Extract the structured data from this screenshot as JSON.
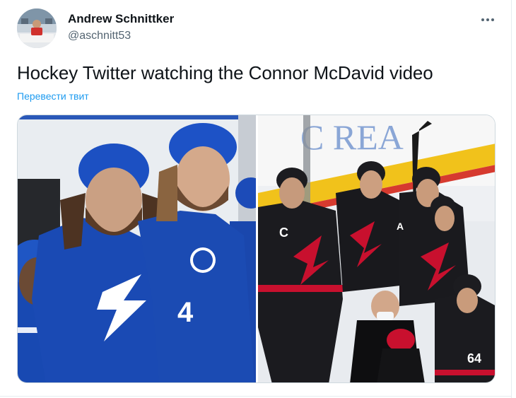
{
  "author": {
    "display_name": "Andrew Schnittker",
    "handle": "@aschnitt53"
  },
  "tweet": {
    "text": "Hockey Twitter watching the Connor McDavid video",
    "translate_label": "Перевести твит"
  },
  "media": {
    "left_photo": {
      "jersey_number": "4"
    },
    "right_photo": {
      "arena_board_text": "C REA",
      "captain_letter": "C",
      "alternate_letter": "A",
      "jersey_number": "64"
    }
  },
  "colors": {
    "link": "#1d9bf0",
    "text_primary": "#0f1419",
    "text_secondary": "#536471",
    "lightning_blue": "#1a4fb5",
    "hurricanes_red": "#c8102e"
  },
  "icons": {
    "more": "more-horizontal-icon"
  }
}
